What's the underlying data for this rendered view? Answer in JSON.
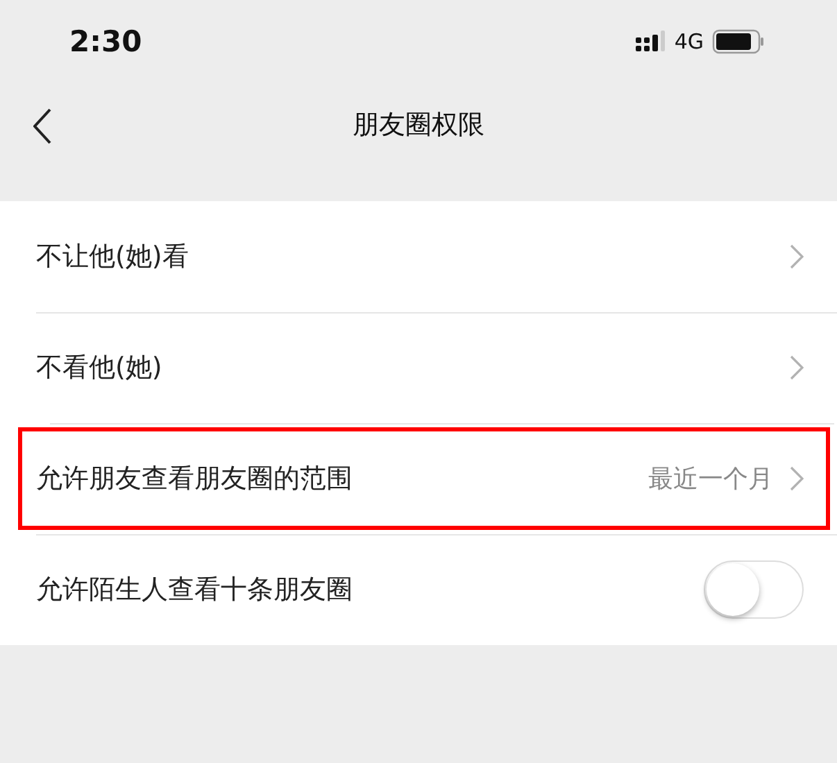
{
  "status_bar": {
    "time": "2:30",
    "network": "4G"
  },
  "nav": {
    "title": "朋友圈权限"
  },
  "rows": [
    {
      "kind": "link",
      "label": "不让他(她)看",
      "highlighted": false
    },
    {
      "kind": "link",
      "label": "不看他(她)",
      "highlighted": false
    },
    {
      "kind": "link",
      "label": "允许朋友查看朋友圈的范围",
      "value": "最近一个月",
      "highlighted": true
    },
    {
      "kind": "toggle",
      "label": "允许陌生人查看十条朋友圈",
      "on": false,
      "highlighted": false
    }
  ]
}
